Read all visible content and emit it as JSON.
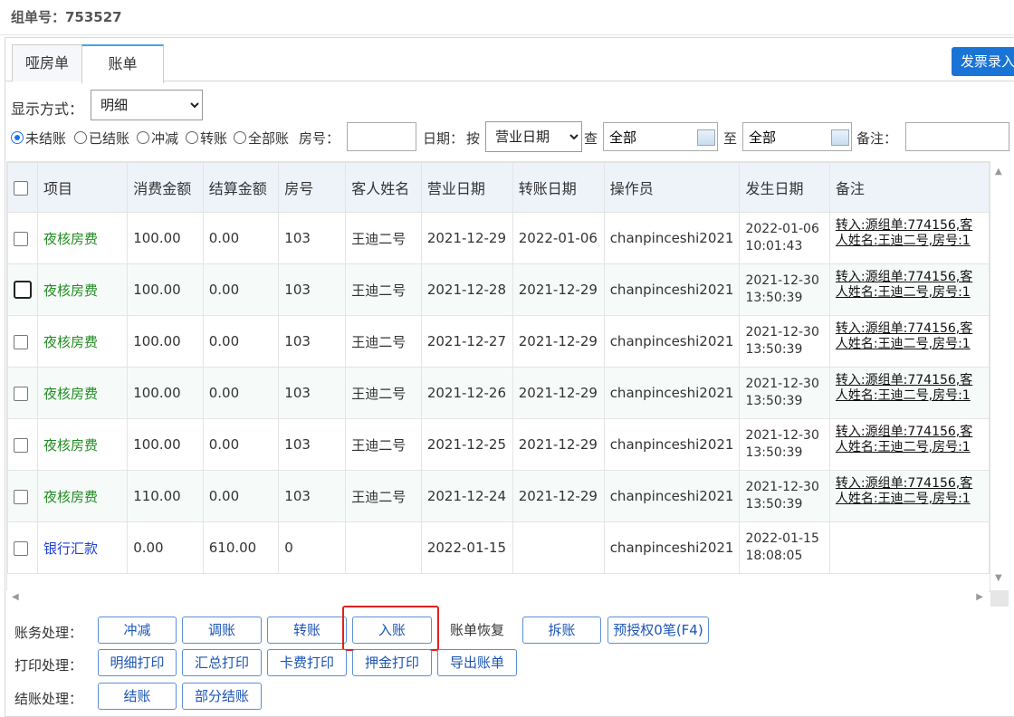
{
  "header": {
    "order_label": "组单号：753527"
  },
  "tabs": [
    {
      "label": "哑房单"
    },
    {
      "label": "账单"
    }
  ],
  "invoice_button": "发票录入",
  "filters": {
    "display_label": "显示方式：",
    "display_value": "明细",
    "radios": [
      "未结账",
      "已结账",
      "冲减",
      "转账",
      "全部账"
    ],
    "room_label": "房号：",
    "date_label": "日期：",
    "by_label": "按",
    "date_type": "营业日期",
    "check_label": "查",
    "from_value": "全部",
    "to_label": "至",
    "to_value": "全部",
    "note_label": "备注："
  },
  "table": {
    "headers": [
      "项目",
      "消费金额",
      "结算金额",
      "房号",
      "客人姓名",
      "营业日期",
      "转账日期",
      "操作员",
      "发生日期",
      "备注"
    ],
    "rows": [
      {
        "item": "夜核房费",
        "consume": "100.00",
        "settle": "0.00",
        "room": "103",
        "guest": "王迪二号",
        "biz_date": "2021-12-29",
        "transfer_date": "2022-01-06",
        "operator": "chanpinceshi2021",
        "occur_date": "2022-01-06",
        "occur_time": "10:01:43",
        "note": "转入:源组单:774156,客人姓名:王迪二号,房号:1"
      },
      {
        "item": "夜核房费",
        "consume": "100.00",
        "settle": "0.00",
        "room": "103",
        "guest": "王迪二号",
        "biz_date": "2021-12-28",
        "transfer_date": "2021-12-29",
        "operator": "chanpinceshi2021",
        "occur_date": "2021-12-30",
        "occur_time": "13:50:39",
        "note": "转入:源组单:774156,客人姓名:王迪二号,房号:1"
      },
      {
        "item": "夜核房费",
        "consume": "100.00",
        "settle": "0.00",
        "room": "103",
        "guest": "王迪二号",
        "biz_date": "2021-12-27",
        "transfer_date": "2021-12-29",
        "operator": "chanpinceshi2021",
        "occur_date": "2021-12-30",
        "occur_time": "13:50:39",
        "note": "转入:源组单:774156,客人姓名:王迪二号,房号:1"
      },
      {
        "item": "夜核房费",
        "consume": "100.00",
        "settle": "0.00",
        "room": "103",
        "guest": "王迪二号",
        "biz_date": "2021-12-26",
        "transfer_date": "2021-12-29",
        "operator": "chanpinceshi2021",
        "occur_date": "2021-12-30",
        "occur_time": "13:50:39",
        "note": "转入:源组单:774156,客人姓名:王迪二号,房号:1"
      },
      {
        "item": "夜核房费",
        "consume": "100.00",
        "settle": "0.00",
        "room": "103",
        "guest": "王迪二号",
        "biz_date": "2021-12-25",
        "transfer_date": "2021-12-29",
        "operator": "chanpinceshi2021",
        "occur_date": "2021-12-30",
        "occur_time": "13:50:39",
        "note": "转入:源组单:774156,客人姓名:王迪二号,房号:1"
      },
      {
        "item": "夜核房费",
        "consume": "110.00",
        "settle": "0.00",
        "room": "103",
        "guest": "王迪二号",
        "biz_date": "2021-12-24",
        "transfer_date": "2021-12-29",
        "operator": "chanpinceshi2021",
        "occur_date": "2021-12-30",
        "occur_time": "13:50:39",
        "note": "转入:源组单:774156,客人姓名:王迪二号,房号:1"
      },
      {
        "item": "银行汇款",
        "consume": "0.00",
        "settle": "610.00",
        "room": "0",
        "guest": "",
        "biz_date": "2022-01-15",
        "transfer_date": "",
        "operator": "chanpinceshi2021",
        "occur_date": "2022-01-15",
        "occur_time": "18:08:05",
        "note": ""
      }
    ]
  },
  "actions": {
    "finance_label": "账务处理：",
    "finance": [
      "冲减",
      "调账",
      "转账",
      "入账",
      "账单恢复",
      "拆账",
      "预授权0笔(F4)"
    ],
    "print_label": "打印处理：",
    "print": [
      "明细打印",
      "汇总打印",
      "卡费打印",
      "押金打印",
      "导出账单"
    ],
    "checkout_label": "结账处理：",
    "checkout": [
      "结账",
      "部分结账"
    ]
  },
  "colors": {
    "accent": "#1a74d6",
    "highlight": "#e02020",
    "item_green": "#228B22",
    "bank_blue": "#1c3fd6"
  }
}
